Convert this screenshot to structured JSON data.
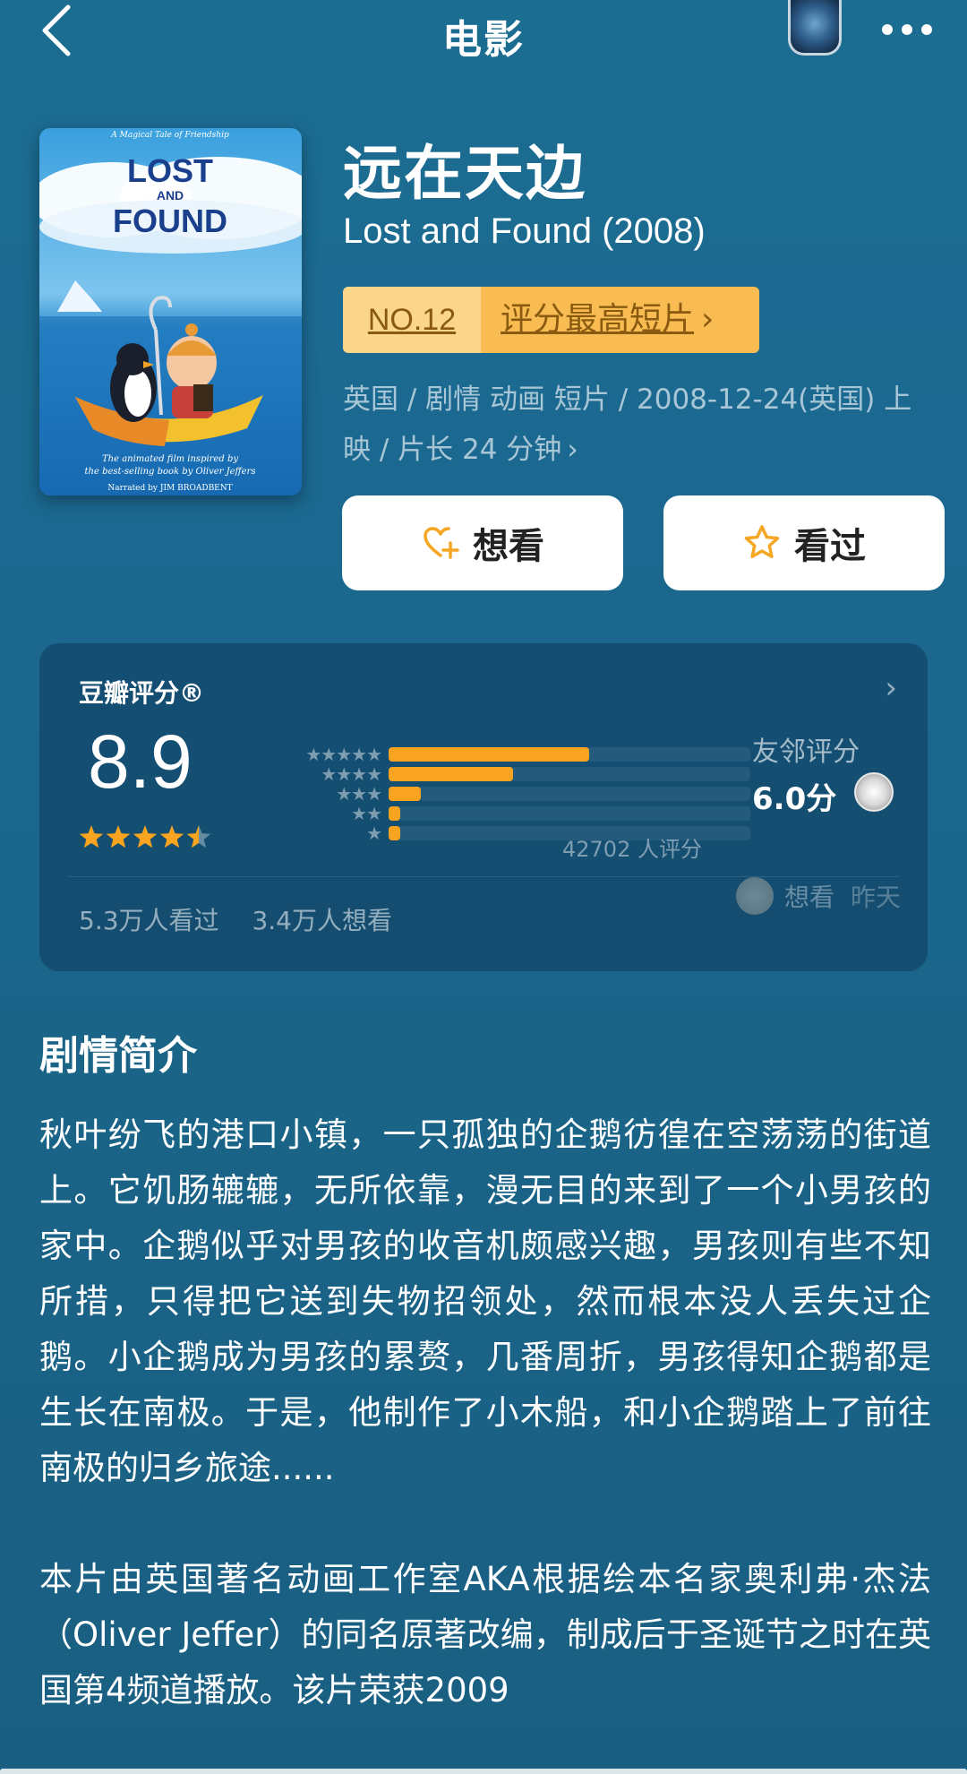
{
  "nav": {
    "title": "电影"
  },
  "movie": {
    "title_cn": "远在天边",
    "title_en": "Lost and Found (2008)",
    "rank_no": "NO.12",
    "rank_label": "评分最高短片",
    "meta": "英国 / 剧情 动画 短片 / 2008-12-24(英国) 上映 / 片长 24 分钟",
    "poster": {
      "tagline": "A Magical Tale of Friendship",
      "title_line1": "LOST",
      "title_line2": "AND",
      "title_line3": "FOUND",
      "caption_line1": "The animated film inspired by",
      "caption_line2": "the best-selling book by Oliver Jeffers",
      "narrator": "Narrated by JIM BROADBENT"
    }
  },
  "actions": {
    "want_label": "想看",
    "seen_label": "看过"
  },
  "rating": {
    "title": "豆瓣评分®",
    "score": "8.9",
    "stars_value": 4.5,
    "distribution": [
      {
        "stars": "★★★★★",
        "fraction": 0.555
      },
      {
        "stars": "★★★★",
        "fraction": 0.345
      },
      {
        "stars": "★★★",
        "fraction": 0.09
      },
      {
        "stars": "★★",
        "fraction": 0.033
      },
      {
        "stars": "★",
        "fraction": 0.033
      }
    ],
    "count": "42702 人评分",
    "friend_label": "友邻评分",
    "friend_score": "6.0分",
    "watched": "5.3万人看过",
    "wish": "3.4万人想看",
    "activity_action": "想看",
    "activity_time": "昨天"
  },
  "synopsis": {
    "title": "剧情简介",
    "para1": "秋叶纷飞的港口小镇，一只孤独的企鹅彷徨在空荡荡的街道上。它饥肠辘辘，无所依靠，漫无目的来到了一个小男孩的家中。企鹅似乎对男孩的收音机颇感兴趣，男孩则有些不知所措，只得把它送到失物招领处，然而根本没人丢失过企鹅。小企鹅成为男孩的累赘，几番周折，男孩得知企鹅都是生长在南极。于是，他制作了小木船，和小企鹅踏上了前往南极的归乡旅途......",
    "para2": "本片由英国著名动画工作室AKA根据绘本名家奥利弗·杰法（Oliver Jeffer）的同名原著改编，制成后于圣诞节之时在英国第4频道播放。该片荣获2009"
  },
  "colors": {
    "background": "#1b6890",
    "accent": "#f8a420",
    "badge_left": "#fbd68a",
    "badge_right": "#f8bc52"
  }
}
